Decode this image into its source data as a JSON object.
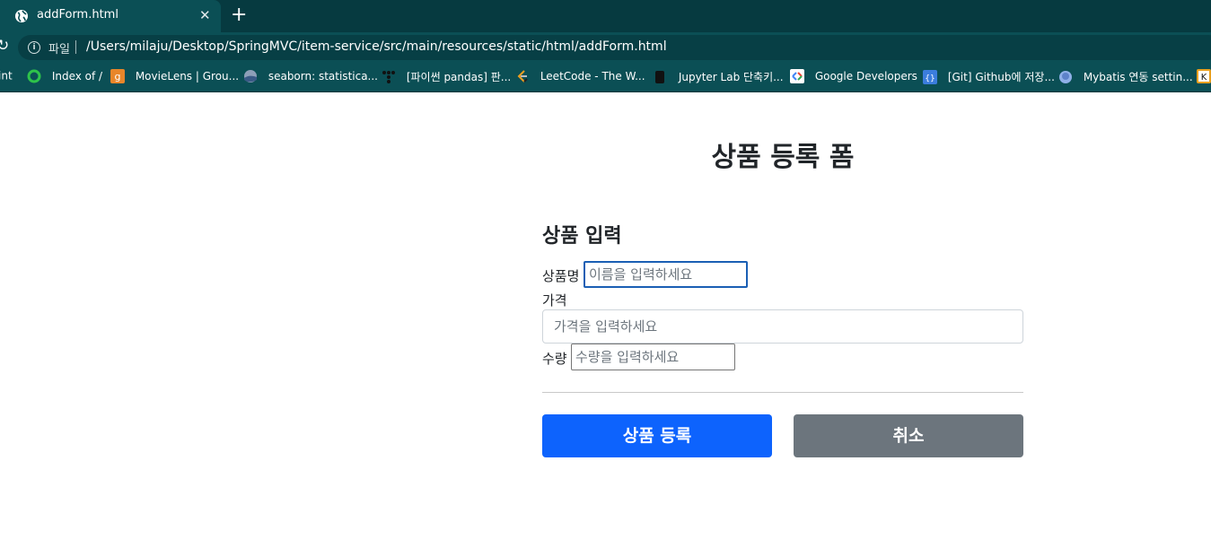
{
  "browser": {
    "tab": {
      "title": "addForm.html"
    },
    "address_bar": {
      "scheme_label": "파일",
      "url": "/Users/milaju/Desktop/SpringMVC/item-service/src/main/resources/static/html/addForm.html"
    },
    "bookmarks": [
      {
        "label": "int",
        "icon": "partial-bookmark"
      },
      {
        "label": "Index of /",
        "icon": "circle-icon"
      },
      {
        "label": "MovieLens | Grou...",
        "icon": "grouplens-icon"
      },
      {
        "label": "seaborn: statistica...",
        "icon": "seaborn-icon"
      },
      {
        "label": "[파이썬 pandas] 판...",
        "icon": "tistory-icon"
      },
      {
        "label": "LeetCode - The W...",
        "icon": "leetcode-icon"
      },
      {
        "label": "Jupyter Lab 단축키...",
        "icon": "jupyter-icon"
      },
      {
        "label": "Google Developers",
        "icon": "google-dev-icon"
      },
      {
        "label": "[Git] Github에 저장...",
        "icon": "code-icon"
      },
      {
        "label": "Mybatis 연동 settin...",
        "icon": "mybatis-icon"
      }
    ]
  },
  "page": {
    "title": "상품 등록 폼",
    "section_title": "상품 입력",
    "fields": {
      "name": {
        "label": "상품명",
        "placeholder": "이름을 입력하세요"
      },
      "price": {
        "label": "가격",
        "placeholder": "가격을 입력하세요"
      },
      "quantity": {
        "label": "수량",
        "placeholder": "수량을 입력하세요"
      }
    },
    "buttons": {
      "submit": "상품 등록",
      "cancel": "취소"
    }
  },
  "colors": {
    "primary": "#0d63fd",
    "secondary": "#6c757d",
    "chrome": "#0b4f55"
  }
}
